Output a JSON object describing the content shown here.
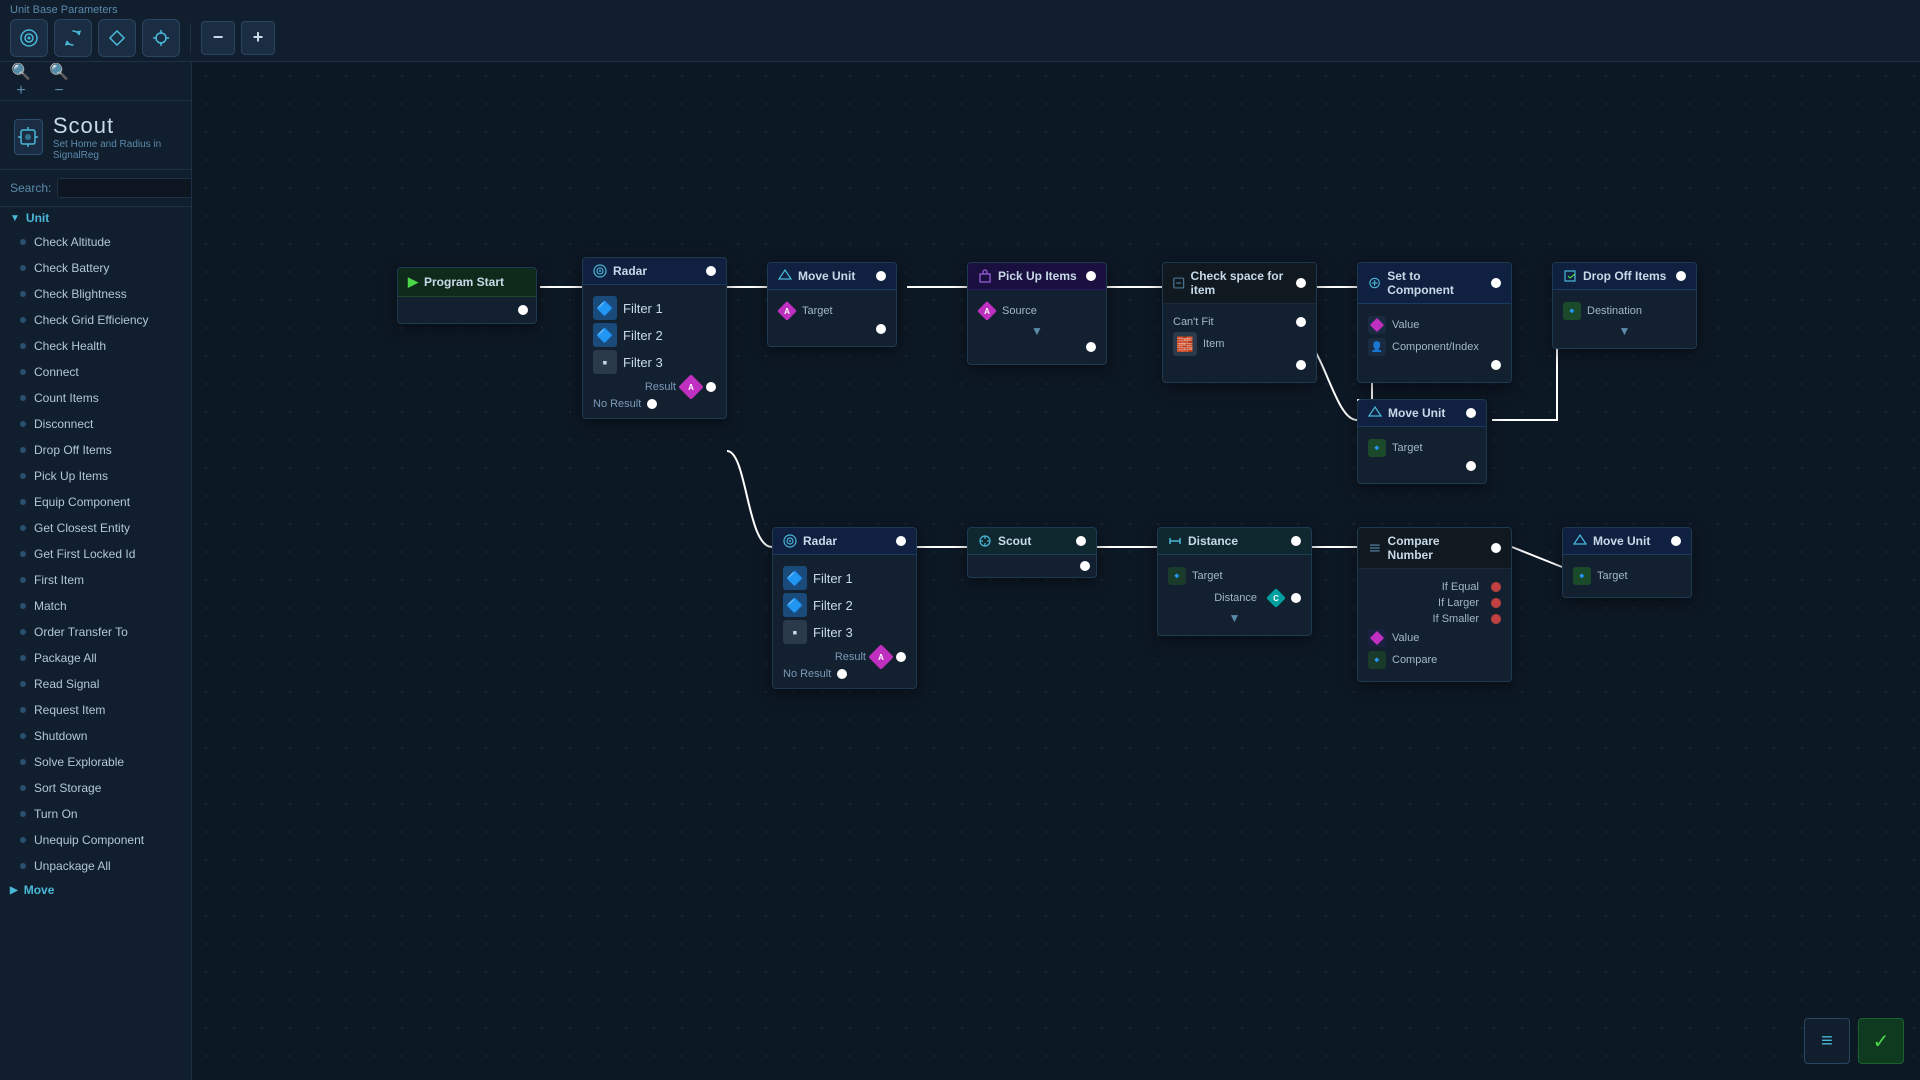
{
  "toolbar": {
    "title": "Unit Base Parameters",
    "icons": [
      "radar-icon",
      "cycle-icon",
      "diamond-icon",
      "crosshair-icon"
    ],
    "zoom_minus": "−",
    "zoom_plus": "+"
  },
  "unit": {
    "title": "Scout",
    "subtitle": "Set Home and Radius in SignalReg",
    "icon": "◈"
  },
  "search": {
    "label": "Search:",
    "placeholder": ""
  },
  "sidebar": {
    "section_unit": "Unit",
    "items": [
      "Check Altitude",
      "Check Battery",
      "Check Blightness",
      "Check Grid Efficiency",
      "Check Health",
      "Connect",
      "Count Items",
      "Disconnect",
      "Drop Off Items",
      "Pick Up Items",
      "Equip Component",
      "Get Closest Entity",
      "Get First Locked Id",
      "First Item",
      "Match",
      "Order Transfer To",
      "Package All",
      "Read Signal",
      "Request Item",
      "Shutdown",
      "Solve Explorable",
      "Sort Storage",
      "Turn On",
      "Unequip Component",
      "Unpackage All"
    ],
    "section_move": "Move"
  },
  "nodes": {
    "program_start": {
      "label": "Program Start"
    },
    "radar1": {
      "label": "Radar",
      "filters": [
        "Filter 1",
        "Filter 2",
        "Filter 3"
      ],
      "result": "Result",
      "no_result": "No Result"
    },
    "radar2": {
      "label": "Radar",
      "filters": [
        "Filter 1",
        "Filter 2",
        "Filter 3"
      ],
      "result": "Result",
      "no_result": "No Result"
    },
    "move_unit1": {
      "label": "Move Unit",
      "target": "Target"
    },
    "move_unit2": {
      "label": "Move Unit",
      "target": "Target"
    },
    "move_unit3": {
      "label": "Move Unit",
      "target": "Target"
    },
    "pickup": {
      "label": "Pick Up Items",
      "source": "Source"
    },
    "checkspace": {
      "label": "Check space for item",
      "cant_fit": "Can't Fit",
      "item": "Item"
    },
    "setcomp": {
      "label": "Set to Component",
      "value": "Value",
      "comp_index": "Component/Index"
    },
    "dropoff": {
      "label": "Drop Off Items",
      "destination": "Destination"
    },
    "scout": {
      "label": "Scout"
    },
    "distance": {
      "label": "Distance",
      "target": "Target",
      "distance": "Distance"
    },
    "compare": {
      "label": "Compare Number",
      "if_equal": "If Equal",
      "if_larger": "If Larger",
      "if_smaller": "If Smaller",
      "value": "Value",
      "compare": "Compare"
    }
  },
  "bottom_right": {
    "list_icon": "≡",
    "check_icon": "✓"
  }
}
